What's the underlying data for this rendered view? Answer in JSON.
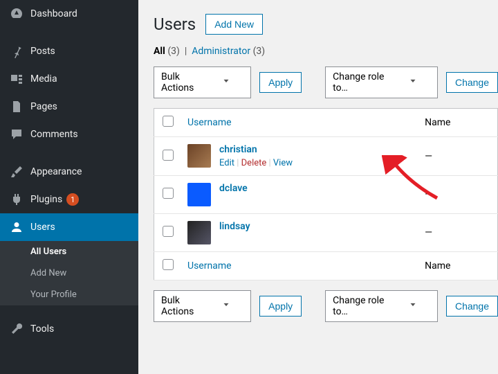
{
  "sidebar": {
    "items": [
      {
        "label": "Dashboard",
        "icon": "gauge-icon"
      },
      {
        "label": "Posts",
        "icon": "pin-icon"
      },
      {
        "label": "Media",
        "icon": "media-icon"
      },
      {
        "label": "Pages",
        "icon": "page-icon"
      },
      {
        "label": "Comments",
        "icon": "comment-icon"
      },
      {
        "label": "Appearance",
        "icon": "brush-icon"
      },
      {
        "label": "Plugins",
        "icon": "plug-icon",
        "badge": "1"
      },
      {
        "label": "Users",
        "icon": "user-icon",
        "active": true
      },
      {
        "label": "Tools",
        "icon": "wrench-icon"
      }
    ],
    "submenu": [
      {
        "label": "All Users",
        "current": true
      },
      {
        "label": "Add New"
      },
      {
        "label": "Your Profile"
      }
    ]
  },
  "page": {
    "title": "Users",
    "add_new": "Add New"
  },
  "filters": {
    "all_label": "All",
    "all_count": "(3)",
    "sep": "|",
    "admin_label": "Administrator",
    "admin_count": "(3)"
  },
  "toolbar": {
    "bulk_label": "Bulk Actions",
    "apply": "Apply",
    "role_label": "Change role to…",
    "change": "Change"
  },
  "columns": {
    "username": "Username",
    "name": "Name"
  },
  "rows": [
    {
      "username": "christian",
      "name": "—",
      "avatar_bg": "linear-gradient(135deg,#6b4226,#a77b52)",
      "actions": true
    },
    {
      "username": "dclave",
      "name": "—",
      "avatar_bg": "#0a5bff"
    },
    {
      "username": "lindsay",
      "name": "—",
      "avatar_bg": "linear-gradient(135deg,#222,#556)"
    }
  ],
  "actions": {
    "edit": "Edit",
    "delete": "Delete",
    "view": "View"
  }
}
